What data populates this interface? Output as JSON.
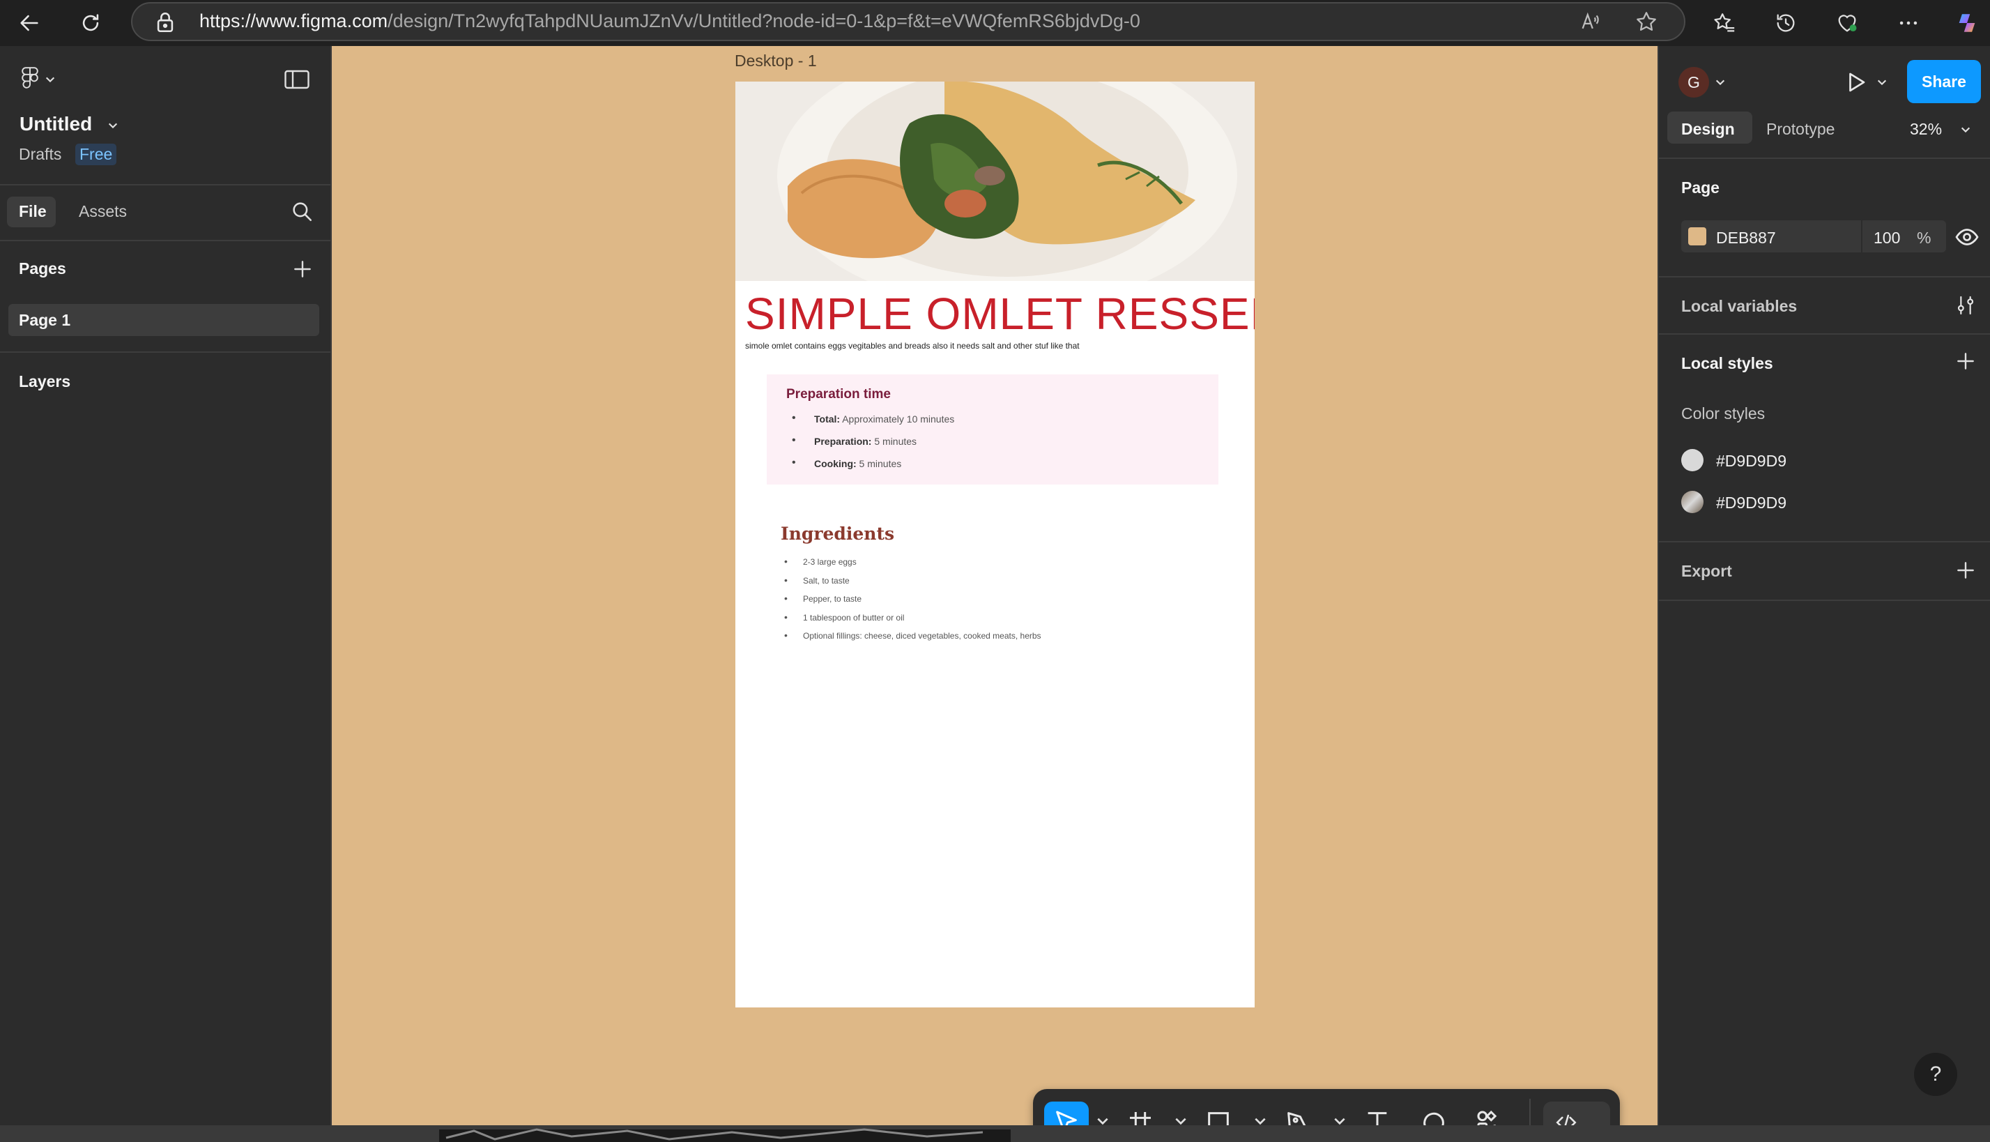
{
  "browser": {
    "url_domain": "https://www.figma.com",
    "url_path": "/design/Tn2wyfqTahpdNUaumJZnVv/Untitled?node-id=0-1&p=f&t=eVWQfemRS6bjdvDg-0"
  },
  "file": {
    "title": "Untitled",
    "location": "Drafts",
    "plan_badge": "Free"
  },
  "left_panel": {
    "tabs": [
      "File",
      "Assets"
    ],
    "pages_heading": "Pages",
    "pages": [
      "Page 1"
    ],
    "layers_heading": "Layers"
  },
  "canvas": {
    "background": "#DEB887",
    "frame_label": "Desktop - 1",
    "recipe": {
      "title": "SIMPLE OMLET RESSEPI",
      "subtitle": "simole omlet contains eggs vegitables and breads also it needs salt and other stuf like that",
      "prep_heading": "Preparation time",
      "prep_items": [
        {
          "label": "Total:",
          "value": " Approximately 10 minutes"
        },
        {
          "label": "Preparation:",
          "value": " 5 minutes"
        },
        {
          "label": "Cooking:",
          "value": " 5 minutes"
        }
      ],
      "ingredients_heading": "Ingredients",
      "ingredients": [
        "2-3 large eggs",
        "Salt, to taste",
        "Pepper, to taste",
        "1 tablespoon of butter or oil",
        "Optional fillings: cheese, diced vegetables, cooked meats, herbs"
      ]
    }
  },
  "right_panel": {
    "avatar_initial": "G",
    "share_label": "Share",
    "tabs": [
      "Design",
      "Prototype"
    ],
    "zoom": "32%",
    "page_heading": "Page",
    "page_color_hex": "DEB887",
    "page_color_swatch": "#DEB887",
    "page_opacity": "100",
    "percent_sign": "%",
    "local_variables": "Local variables",
    "local_styles": "Local styles",
    "color_styles_heading": "Color styles",
    "color_styles": [
      "#D9D9D9",
      "#D9D9D9"
    ],
    "export": "Export",
    "help": "?"
  },
  "colors": {
    "accent": "#0d99ff",
    "title_red": "#c8202a"
  }
}
